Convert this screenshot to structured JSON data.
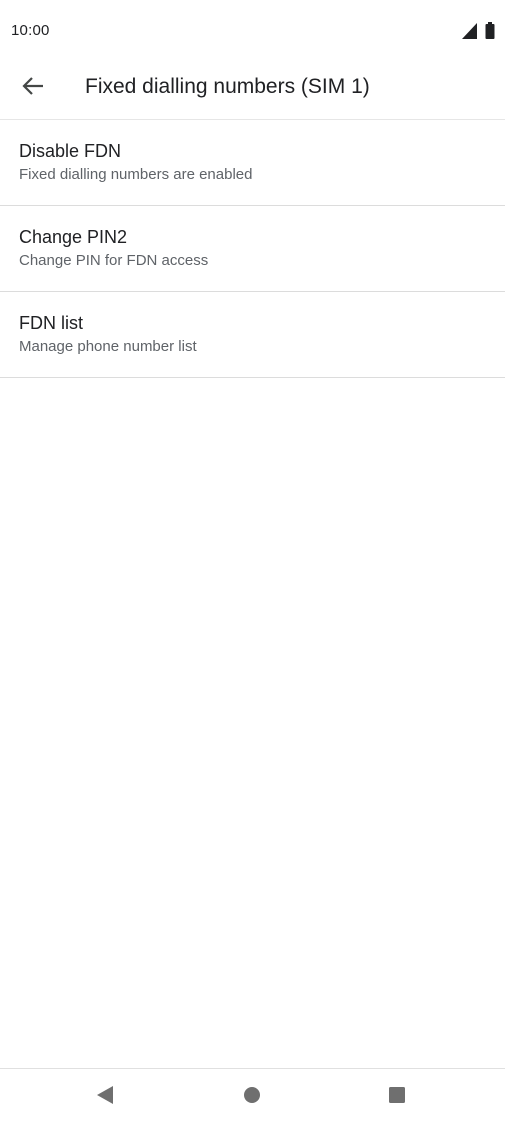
{
  "status_bar": {
    "time": "10:00",
    "icons": [
      "signal-icon",
      "battery-icon"
    ]
  },
  "app_bar": {
    "back_icon": "arrow-back-icon",
    "title": "Fixed dialling numbers (SIM 1)"
  },
  "settings": {
    "items": [
      {
        "title": "Disable FDN",
        "summary": "Fixed dialling numbers are enabled"
      },
      {
        "title": "Change PIN2",
        "summary": "Change PIN for FDN access"
      },
      {
        "title": "FDN list",
        "summary": "Manage phone number list"
      }
    ]
  },
  "nav_bar": {
    "icons": [
      "nav-back-icon",
      "nav-home-icon",
      "nav-recents-icon"
    ]
  },
  "colors": {
    "text_primary": "#202124",
    "text_secondary": "#5f6368",
    "divider": "#dcdcdc",
    "nav_icon": "#6f6f6f"
  }
}
